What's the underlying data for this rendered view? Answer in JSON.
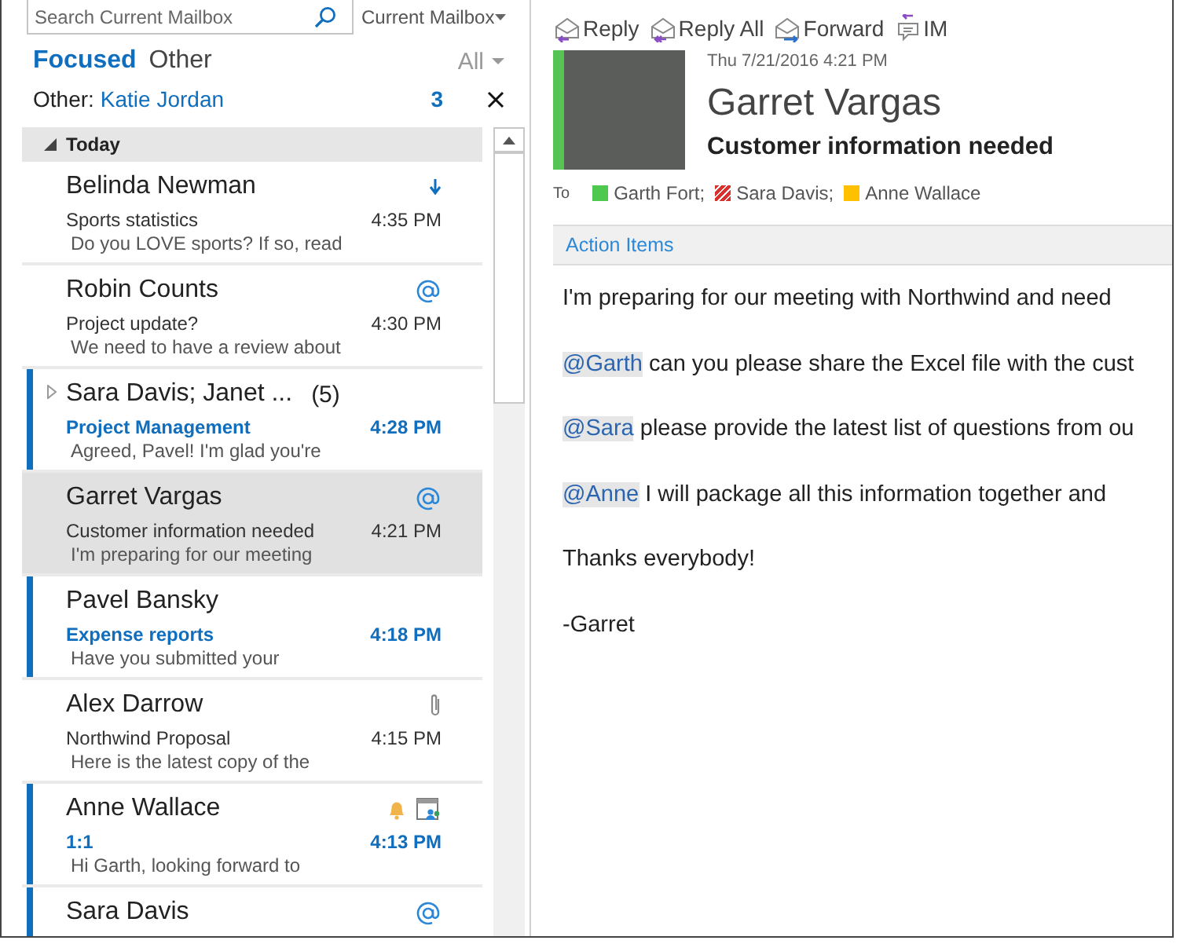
{
  "search": {
    "placeholder": "Search Current Mailbox",
    "scope": "Current Mailbox"
  },
  "tabs": [
    {
      "label": "Focused",
      "selected": true
    },
    {
      "label": "Other",
      "selected": false
    }
  ],
  "filter": "All",
  "other_notice": {
    "label": "Other:",
    "name": "Katie Jordan",
    "count": "3"
  },
  "group": {
    "label": "Today",
    "expanded": true
  },
  "messages": [
    {
      "sender": "Belinda Newman",
      "subject": "Sports statistics",
      "preview": "Do you LOVE sports?  If so, read",
      "time": "4:35 PM",
      "kind": "low-priority",
      "unread": false,
      "selected": false
    },
    {
      "sender": "Robin Counts",
      "subject": "Project update?",
      "preview": "We need to have a review about",
      "time": "4:30 PM",
      "kind": "mention",
      "unread": false,
      "selected": false
    },
    {
      "sender": "Sara Davis;  Janet ...",
      "thread_count": "(5)",
      "subject": "Project Management",
      "preview": "Agreed, Pavel! I'm glad you're",
      "time": "4:28 PM",
      "kind": "plain",
      "unread": true,
      "selected": false
    },
    {
      "sender": "Garret Vargas",
      "subject": "Customer information needed",
      "preview": "I'm preparing for our meeting",
      "time": "4:21 PM",
      "kind": "mention",
      "unread": false,
      "selected": true
    },
    {
      "sender": "Pavel Bansky",
      "subject": "Expense reports",
      "preview": "Have you submitted your",
      "time": "4:18 PM",
      "kind": "plain",
      "unread": true,
      "selected": false
    },
    {
      "sender": "Alex Darrow",
      "subject": "Northwind Proposal",
      "preview": "Here is the latest copy of the",
      "time": "4:15 PM",
      "kind": "attachment",
      "unread": false,
      "selected": false
    },
    {
      "sender": "Anne Wallace",
      "subject": "1:1",
      "preview": "Hi Garth, looking forward to",
      "time": "4:13 PM",
      "kind": "reminder",
      "unread": true,
      "selected": false
    },
    {
      "sender": "Sara Davis",
      "kind": "mention",
      "unread": true,
      "selected": false
    }
  ],
  "actions": [
    {
      "label": "Reply",
      "kind": "reply"
    },
    {
      "label": "Reply All",
      "kind": "reply-all"
    },
    {
      "label": "Forward",
      "kind": "forward"
    },
    {
      "label": "IM",
      "kind": "im"
    }
  ],
  "reading": {
    "date": "Thu 7/21/2016 4:21 PM",
    "sender": "Garret Vargas",
    "subject": "Customer information needed",
    "to_label": "To",
    "recipients": [
      {
        "name": "Garth Fort;",
        "color": "#4fc84f",
        "kind": "solid"
      },
      {
        "name": "Sara Davis;",
        "color": "#d9302c",
        "kind": "striped"
      },
      {
        "name": "Anne Wallace",
        "color": "#ffc000",
        "kind": "solid"
      }
    ],
    "banner": "Action Items",
    "body": [
      {
        "text": "I'm preparing for our meeting with Northwind and need"
      },
      {
        "mention": "@Garth",
        "text": " can you please share the Excel file with the cust"
      },
      {
        "mention": "@Sara",
        "text": " please provide the latest list of questions from ou"
      },
      {
        "mention": "@Anne",
        "text": " I will package all this information together and"
      },
      {
        "text": "Thanks everybody!"
      },
      {
        "text": "-Garret"
      }
    ]
  }
}
